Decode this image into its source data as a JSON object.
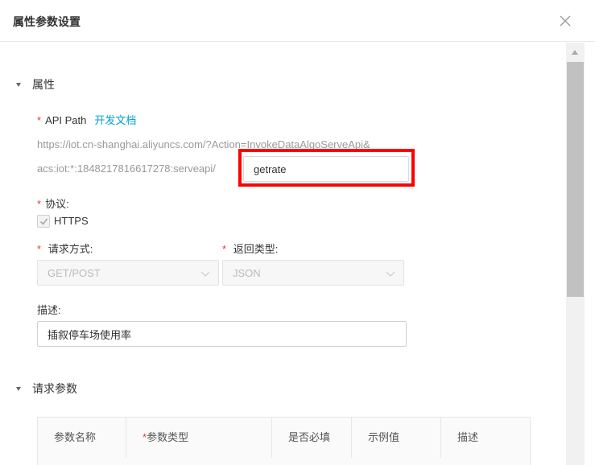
{
  "dialog": {
    "title": "属性参数设置"
  },
  "sections": {
    "properties": "属性",
    "request_params": "请求参数"
  },
  "api_path": {
    "label": "API Path",
    "doc_link": "开发文档",
    "prefix_line1": "https://iot.cn-shanghai.aliyuncs.com/?Action=InvokeDataAlgoServeApi&",
    "prefix_line2": "acs:iot:*:1848217816617278:serveapi/",
    "value": "getrate"
  },
  "protocol": {
    "label": "协议:",
    "option": "HTTPS",
    "checked": true
  },
  "request_method": {
    "label": "请求方式:",
    "value": "GET/POST"
  },
  "return_type": {
    "label": "返回类型:",
    "value": "JSON"
  },
  "description": {
    "label": "描述:",
    "value": "插叙停车场使用率"
  },
  "params_table": {
    "columns": [
      "参数名称",
      "参数类型",
      "是否必填",
      "示例值",
      "描述"
    ]
  },
  "colors": {
    "required": "#e4393c",
    "link": "#00a1d6",
    "highlight": "#ff0000"
  }
}
